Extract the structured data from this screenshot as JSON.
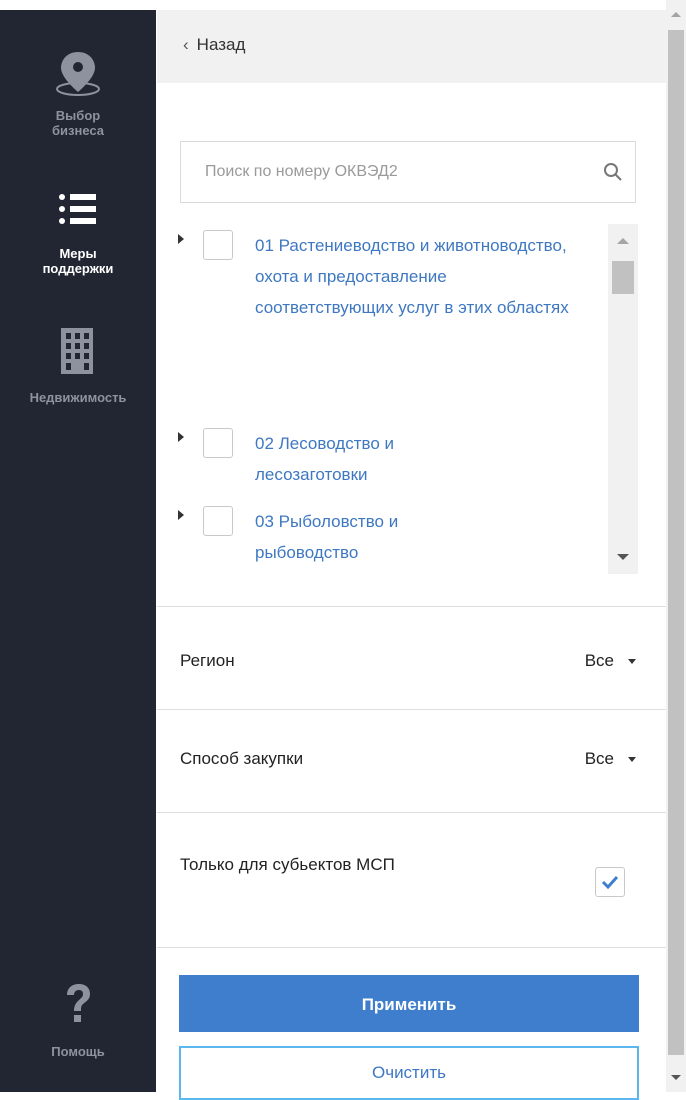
{
  "sidebar": {
    "items": [
      {
        "id": "business",
        "label": "Выбор\nбизнеса",
        "icon": "map-pin-icon",
        "active": false
      },
      {
        "id": "support",
        "label": "Меры\nподдержки",
        "icon": "list-icon",
        "active": true
      },
      {
        "id": "realty",
        "label": "Недвижимость",
        "icon": "building-icon",
        "active": false
      }
    ],
    "help": {
      "label": "Помощь",
      "icon": "question-icon"
    }
  },
  "panel": {
    "back_label": "Назад",
    "search": {
      "placeholder": "Поиск по номеру ОКВЭД2",
      "value": ""
    },
    "tree": [
      {
        "label": "01 Растениеводство и животноводство, охота и предоставление соответствующих услуг в этих областях",
        "checked": false
      },
      {
        "label": "02 Лесоводство и лесозаготовки",
        "checked": false
      },
      {
        "label": "03 Рыболовство и рыбоводство",
        "checked": false
      }
    ],
    "filters": {
      "region": {
        "label": "Регион",
        "value": "Все"
      },
      "procurement": {
        "label": "Способ закупки",
        "value": "Все"
      }
    },
    "msp_only": {
      "label": "Только для субьектов МСП",
      "checked": true
    },
    "apply_label": "Применить",
    "clear_label": "Очистить"
  },
  "colors": {
    "sidebar_bg": "#212632",
    "accent": "#3f7ecd",
    "link": "#3e78c2",
    "clear_border": "#5cb7ef"
  }
}
